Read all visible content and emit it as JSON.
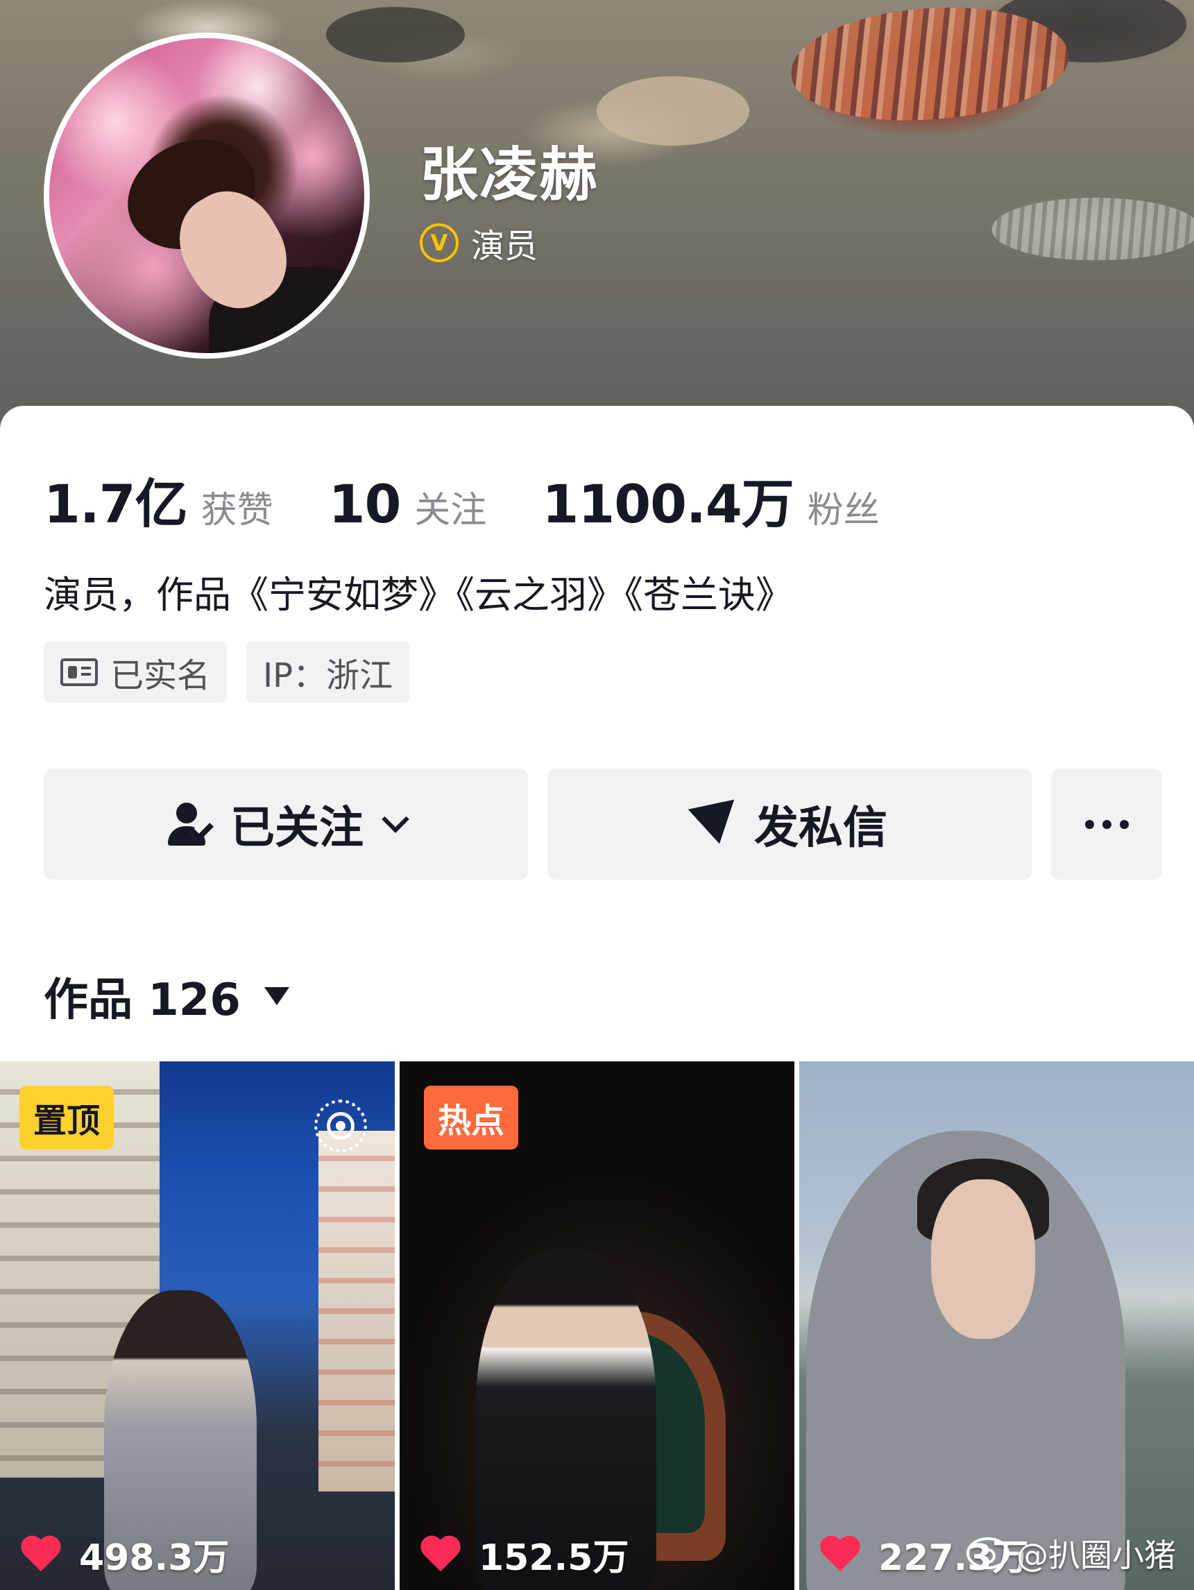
{
  "profile": {
    "name": "张凌赫",
    "verification_badge": "V",
    "verification_label": "演员",
    "accent_color": "#ffc300"
  },
  "stats": [
    {
      "value": "1.7亿",
      "label": "获赞"
    },
    {
      "value": "10",
      "label": "关注"
    },
    {
      "value": "1100.4万",
      "label": "粉丝"
    }
  ],
  "bio": "演员，作品《宁安如梦》《云之羽》《苍兰诀》",
  "tags": {
    "real_name": "已实名",
    "real_name_icon": "id-card-icon",
    "ip": "IP：浙江"
  },
  "actions": {
    "follow_label": "已关注",
    "follow_icon": "user-check-icon",
    "message_label": "发私信",
    "message_icon": "paper-plane-icon",
    "more_icon": "ellipsis-icon"
  },
  "works": {
    "title": "作品 126",
    "items": [
      {
        "badge": "置顶",
        "badge_color": "#ffd12e",
        "icon": "live-photo-icon",
        "likes": "498.3万"
      },
      {
        "badge": "热点",
        "badge_color": "#fe6a3c",
        "likes": "152.5万"
      },
      {
        "likes": "227.3万"
      }
    ]
  },
  "watermark": {
    "icon": "weibo-icon",
    "text": "@扒圈小猪"
  },
  "colors": {
    "heart": "#fe2c55",
    "button_bg": "#f2f2f4",
    "text_primary": "#161823",
    "text_secondary": "#8a8b91"
  }
}
